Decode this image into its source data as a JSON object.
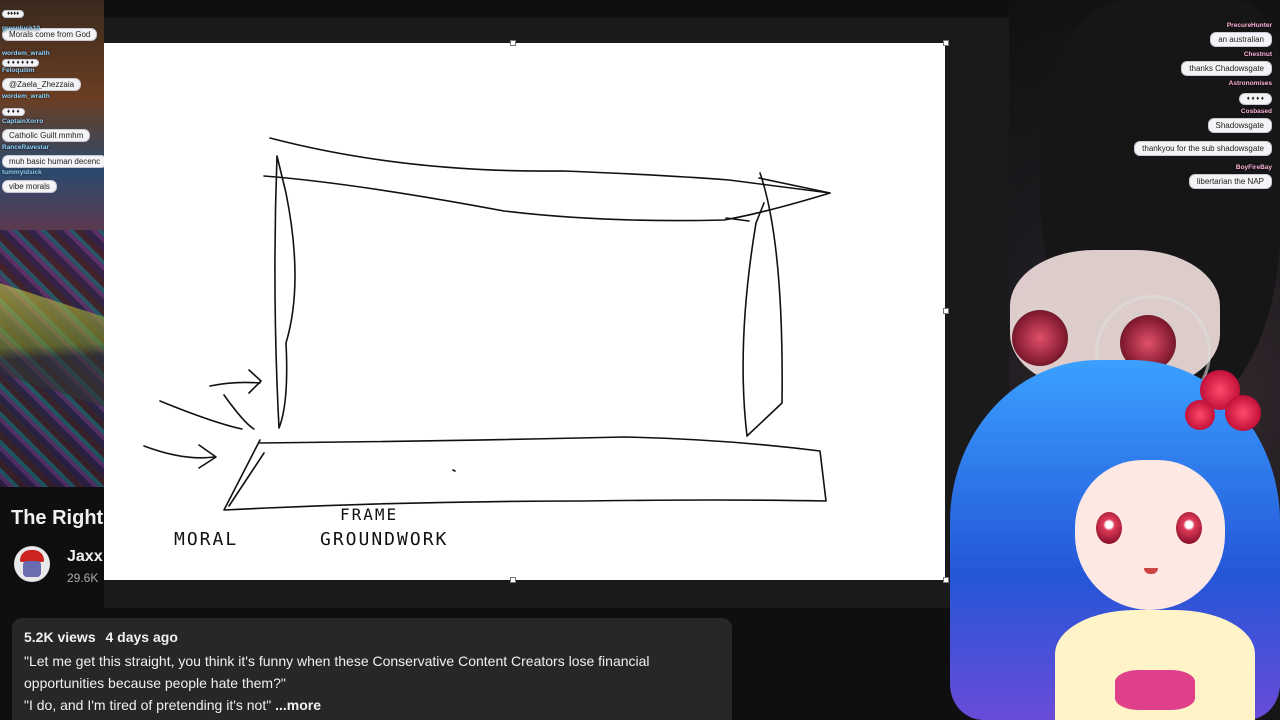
{
  "left_chat": [
    {
      "name": "",
      "message": "Morals come from God"
    },
    {
      "name": "greenluck10",
      "message": ""
    },
    {
      "name": "wordem_wraith",
      "message": ""
    },
    {
      "name": "Feloquilim",
      "message": "@Zaela_Zhezzaia"
    },
    {
      "name": "wordem_wraith",
      "message": ""
    },
    {
      "name": "CaptainXorro",
      "message": "Catholic Guilt mmhm"
    },
    {
      "name": "RanceRavestar",
      "message": "muh basic human decenc"
    },
    {
      "name": "tummyidsick",
      "message": "vibe morals"
    }
  ],
  "video": {
    "title": "The Right",
    "channel": "Jaxx",
    "subscribers": "29.6K"
  },
  "description": {
    "views": "5.2K views",
    "age": "4 days ago",
    "line1": "\"Let me get this straight, you think it's funny when these Conservative Content Creators lose financial",
    "line2": "opportunities because people hate them?\"",
    "line3": "\"I do, and I'm tired of pretending it's not\"",
    "more": "...more"
  },
  "whiteboard": {
    "label_moral": "MORAL",
    "label_frame": "FRAME",
    "label_groundwork": "GROUNDWORK"
  },
  "right_chat": [
    {
      "name": "PrecureHunter",
      "message": "an australian"
    },
    {
      "name": "Chestnut",
      "message": "thanks Chadowsgate"
    },
    {
      "name": "Astronomises",
      "message": ""
    },
    {
      "name": "Cosbased",
      "message": "Shadowsgate"
    },
    {
      "name": "",
      "message": "thankyou for the sub shadowsgate"
    },
    {
      "name": "BoyFireBay",
      "message": "libertarian the NAP"
    }
  ]
}
